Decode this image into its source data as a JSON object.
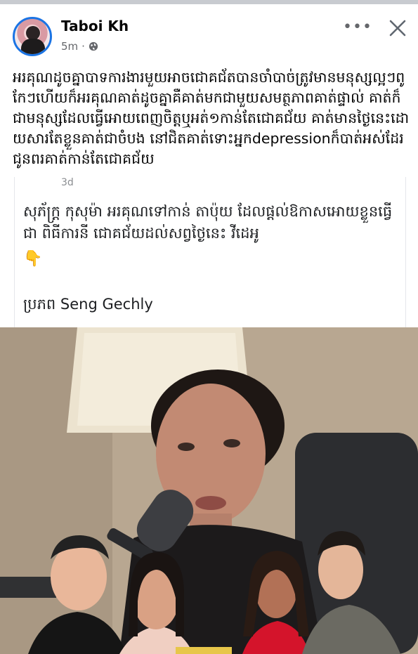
{
  "post": {
    "author": "Taboi Kh",
    "time": "5m",
    "dot": "·",
    "more_label": "•••",
    "caption": "អរគុណដូចគ្នាបាទការងារមួយអាចជោគជ័តបានចាំបាច់ត្រូវមានមនុស្សល្អៗពូកែៗហើយក៏អរគុណគាត់ដូចគ្នាគឺគាត់មកជាមួយសមត្ថភាពគាត់ផ្ទាល់ គាត់ក៏ជាមនុស្សដែលធ្វើអោយពេញចិត្តឬអត់១កាន់តែជោគជ័យ គាត់មានថ្ងៃនេះដោយសារតែខ្លួនគាត់ជាចំបង នៅជិតគាត់ទោះអ្នកdepressionក៏បាត់អស់ដែរ ជូនពរគាត់កាន់តែជោគជ័យ"
  },
  "shared": {
    "time_fragment": "3d",
    "body": "សុភ័ក្រ្ត កុសុម៉ា អរគុណទៅកាន់ តាប៉ុយ ដែលផ្តល់ឱកាសអោយខ្លួនធ្វើជា ពិធីការនី ជោគជ័យដល់សព្វថ្ងៃនេះ វីដេអូ",
    "emoji": "👇",
    "source": "ប្រភព Seng Gechly"
  },
  "colors": {
    "accent": "#1b74e4",
    "secondary_text": "#65676b"
  },
  "icons": {
    "privacy": "globe-icon",
    "options": "more-options-icon",
    "close": "close-icon",
    "pointer": "pointing-down-hand-icon"
  }
}
